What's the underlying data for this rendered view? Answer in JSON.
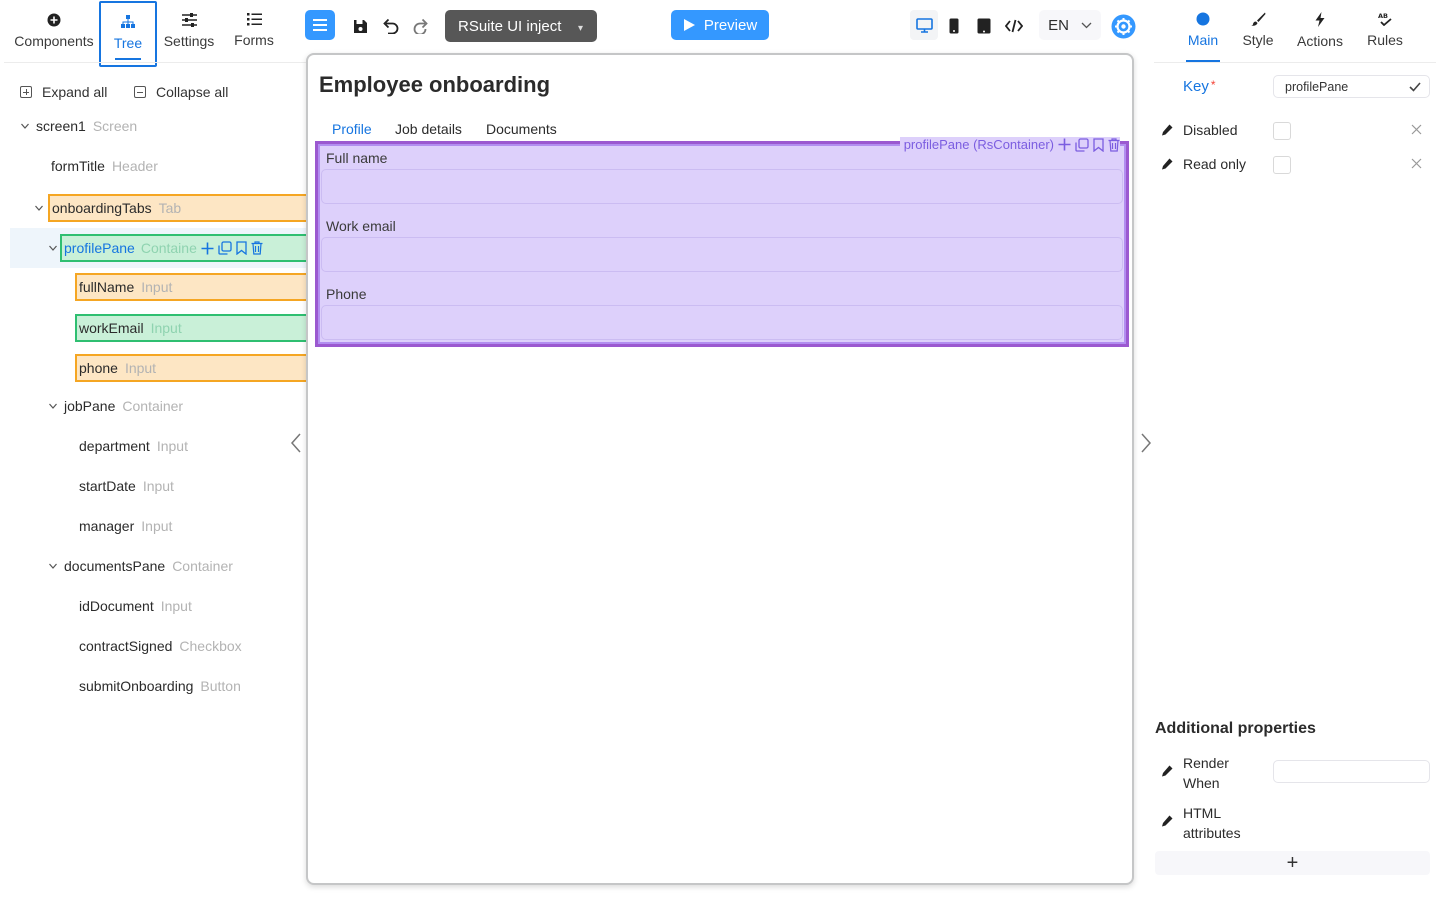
{
  "left_tabs": [
    {
      "label": "Components",
      "icon": "plus-circle-icon"
    },
    {
      "label": "Tree",
      "icon": "sitemap-icon",
      "active": true
    },
    {
      "label": "Settings",
      "icon": "sliders-icon"
    },
    {
      "label": "Forms",
      "icon": "list-icon"
    }
  ],
  "tree_controls": {
    "expand_all": "Expand all",
    "collapse_all": "Collapse all"
  },
  "tree": {
    "screen": {
      "name": "screen1",
      "type": "Screen"
    },
    "form_title": {
      "name": "formTitle",
      "type": "Header"
    },
    "onboarding_tabs": {
      "name": "onboardingTabs",
      "type": "Tab"
    },
    "profile_pane": {
      "name": "profilePane",
      "type": "Containe"
    },
    "full_name": {
      "name": "fullName",
      "type": "Input"
    },
    "work_email": {
      "name": "workEmail",
      "type": "Input"
    },
    "phone": {
      "name": "phone",
      "type": "Input"
    },
    "job_pane": {
      "name": "jobPane",
      "type": "Container"
    },
    "department": {
      "name": "department",
      "type": "Input"
    },
    "start_date": {
      "name": "startDate",
      "type": "Input"
    },
    "manager": {
      "name": "manager",
      "type": "Input"
    },
    "documents_pane": {
      "name": "documentsPane",
      "type": "Container"
    },
    "id_document": {
      "name": "idDocument",
      "type": "Input"
    },
    "contract_signed": {
      "name": "contractSigned",
      "type": "Checkbox"
    },
    "submit_onboarding": {
      "name": "submitOnboarding",
      "type": "Button"
    }
  },
  "toolbar": {
    "theme_select": "RSuite UI inject",
    "preview": "Preview",
    "language": "EN"
  },
  "canvas": {
    "form_title": "Employee onboarding",
    "tabs": [
      "Profile",
      "Job details",
      "Documents"
    ],
    "active_tab": "Profile",
    "selected_label": "profilePane (RsContainer)",
    "fields": [
      {
        "label": "Full name"
      },
      {
        "label": "Work email"
      },
      {
        "label": "Phone"
      }
    ]
  },
  "right_tabs": [
    {
      "label": "Main",
      "icon": "circle-icon",
      "active": true
    },
    {
      "label": "Style",
      "icon": "brush-icon"
    },
    {
      "label": "Actions",
      "icon": "bolt-icon"
    },
    {
      "label": "Rules",
      "icon": "spellcheck-icon"
    }
  ],
  "properties": {
    "key_label": "Key",
    "key_required": "*",
    "key_value": "profilePane",
    "disabled_label": "Disabled",
    "read_only_label": "Read only"
  },
  "additional": {
    "title": "Additional properties",
    "render_when_1": "Render",
    "render_when_2": "When",
    "html_attr_1": "HTML",
    "html_attr_2": "attributes",
    "add": "+"
  },
  "colors": {
    "accent": "#1675e0",
    "primary_button": "#3498ff",
    "selection_purple": "#9b59d0",
    "highlight_orange": "#f5a623",
    "highlight_green": "#2fbf71"
  }
}
